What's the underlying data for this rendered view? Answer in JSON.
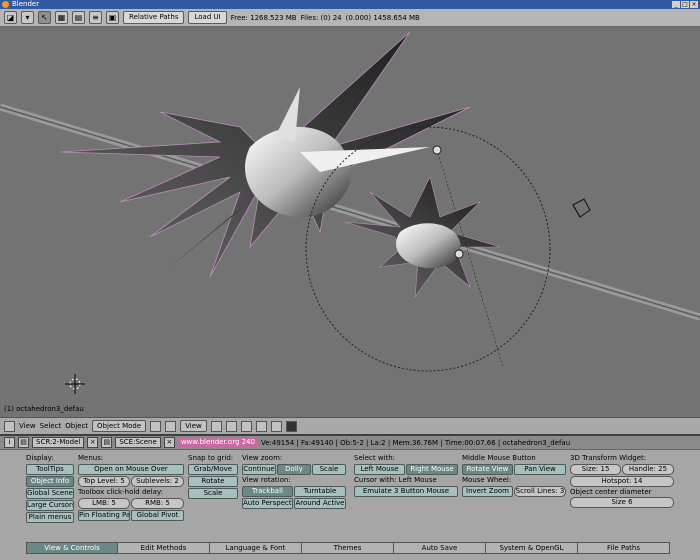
{
  "window": {
    "title": "Blender",
    "controls": [
      "_",
      "□",
      "×"
    ]
  },
  "info_header": {
    "relative_paths": "Relative Paths",
    "load_ui": "Load UI",
    "free": "Free: 1268.523 MB",
    "files": "Files: (0) 24",
    "version": "(0.000) 1458.654 MB"
  },
  "viewport": {
    "object_label": "(1) octahedron3_defau"
  },
  "view3d_header": {
    "menus": [
      "View",
      "Select",
      "Object"
    ],
    "mode": "Object Mode",
    "pivot": "View"
  },
  "status": {
    "screen": "SCR:2-Model",
    "scene": "SCE:Scene",
    "url": "www.blender.org 240",
    "stats": "Ve:49154 | Fa:49140 | Ob:5-2 | La:2 | Mem:36.76M | Time:00:07.66 | octahedron3_defau"
  },
  "prefs": {
    "display": {
      "header": "Display:",
      "tooltips": "ToolTips",
      "object_info": "Object Info",
      "global_scene": "Global Scene",
      "large_cursors": "Large Cursors",
      "plain_menus": "Plain menus"
    },
    "menus": {
      "header": "Menus:",
      "open_mouse_over": "Open on Mouse Over",
      "top_level": "Top Level: 5",
      "sublevels": "Sublevels: 2",
      "click_hold": "Toolbox click-hold delay:",
      "lmb": "LMB: 5",
      "rmb": "RMB: 5",
      "pin_floating": "Pin Floating Pa",
      "global_pivot": "Global Pivot"
    },
    "snap": {
      "header": "Snap to grid:",
      "grab_move": "Grab/Move",
      "rotate": "Rotate",
      "scale": "Scale"
    },
    "view_zoom": {
      "header": "View zoom:",
      "continue": "Continue",
      "dolly": "Dolly",
      "scale": "Scale",
      "rotation_header": "View rotation:",
      "trackball": "Trackball",
      "turntable": "Turntable",
      "auto_perspective": "Auto Perspectiv",
      "around_active": "Around Active"
    },
    "select_with": {
      "header": "Select with:",
      "left_mouse": "Left Mouse",
      "right_mouse": "Right Mouse",
      "cursor_with": "Cursor with: Left Mouse",
      "emulate_3_button": "Emulate 3 Button Mouse"
    },
    "middle_mouse": {
      "header": "Middle Mouse Button",
      "rotate_view": "Rotate View",
      "pan_view": "Pan View",
      "wheel_header": "Mouse Wheel:",
      "invert_zoom": "Invert Zoom",
      "scroll_lines": "Scroll Lines: 3"
    },
    "transform_widget": {
      "header": "3D Transform Widget:",
      "size": "Size: 15",
      "handle": "Handle: 25",
      "hotspot": "Hotspot: 14",
      "diameter_header": "Object center diameter",
      "diameter": "Size 6"
    }
  },
  "tabs": [
    "View & Controls",
    "Edit Methods",
    "Language & Font",
    "Themes",
    "Auto Save",
    "System & OpenGL",
    "File Paths"
  ],
  "colors": {
    "viewport_bg": "#737373",
    "toggle_on": "#6b8787",
    "toggle_off": "#a7bfbf",
    "url_pink": "#c86aa2"
  }
}
